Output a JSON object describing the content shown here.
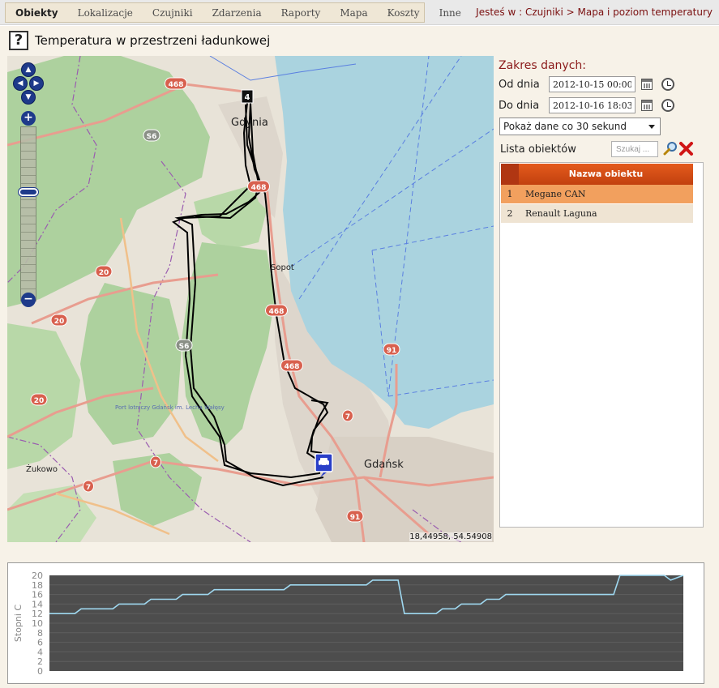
{
  "nav": {
    "items": [
      "Obiekty",
      "Lokalizacje",
      "Czujniki",
      "Zdarzenia",
      "Raporty",
      "Mapa",
      "Koszty",
      "Inne"
    ],
    "active_index": 0
  },
  "breadcrumb": {
    "prefix": "Jesteś w : Czujniki > Mapa i poziom temperatury"
  },
  "page": {
    "help_label": "?",
    "title": "Temperatura w przestrzeni ładunkowej"
  },
  "map": {
    "labels": {
      "gdynia": "Gdynia",
      "sopot": "Sopot",
      "gdansk": "Gdańsk",
      "zukowo": "Żukowo",
      "airport": "Port lotniczy Gdańsk im. Lecha Wałęsy"
    },
    "road_badges": [
      "468",
      "S6",
      "20",
      "20",
      "20",
      "S6",
      "468",
      "468",
      "91",
      "468",
      "7",
      "7",
      "91",
      "7",
      "468"
    ],
    "marker_number": "4",
    "coordinates": "18,44958, 54.54908",
    "colors": {
      "sea": "#aad3df",
      "land": "#e8e3d8",
      "forest": "#add19e",
      "route": "#000000"
    }
  },
  "range": {
    "title": "Zakres danych:",
    "from_label": "Od dnia",
    "from_value": "2012-10-15 00:00",
    "to_label": "Do dnia",
    "to_value": "2012-10-16 18:03",
    "interval_value": "Pokaż dane co 30 sekund"
  },
  "objects": {
    "label": "Lista obiektów",
    "search_placeholder": "Szukaj ...",
    "column_header": "Nazwa obiektu",
    "rows": [
      {
        "num": "1",
        "name": "Megane CAN",
        "selected": true
      },
      {
        "num": "2",
        "name": "Renault Laguna",
        "selected": false
      }
    ]
  },
  "chart_data": {
    "type": "line",
    "title": "",
    "xlabel": "",
    "ylabel": "Stopni C",
    "ylim": [
      0,
      20
    ],
    "yticks": [
      "0",
      "2",
      "4",
      "6",
      "8",
      "10",
      "12",
      "14",
      "16",
      "18",
      "20"
    ],
    "grid": true,
    "line_color": "#9fd8f0",
    "background_color": "#4d4d4d",
    "series": [
      {
        "x": [
          0,
          4,
          5,
          10,
          11,
          15,
          16,
          20,
          21,
          25,
          26,
          30,
          31,
          37,
          38,
          50,
          51,
          55,
          56,
          61,
          62,
          64,
          65,
          68,
          69,
          71,
          72,
          75,
          76,
          78,
          79,
          89,
          90,
          97,
          98,
          100
        ],
        "y": [
          12,
          12,
          13,
          13,
          14,
          14,
          15,
          15,
          16,
          16,
          17,
          17,
          17,
          17,
          18,
          18,
          19,
          19,
          12,
          12,
          13,
          13,
          14,
          14,
          15,
          15,
          16,
          16,
          16,
          16,
          16,
          16,
          20,
          20,
          19,
          20
        ]
      }
    ]
  }
}
